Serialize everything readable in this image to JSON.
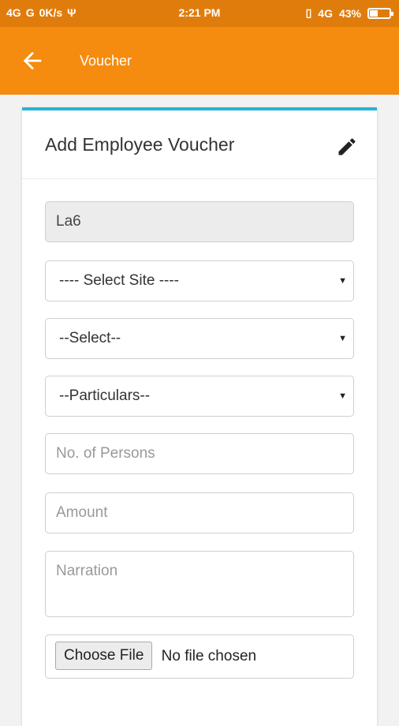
{
  "status_bar": {
    "network1": "4G",
    "network2": "G",
    "speed": "0K/s",
    "time": "2:21 PM",
    "lte": "4G",
    "battery": "43%",
    "battery_level": 0.43
  },
  "toolbar": {
    "title": "Voucher"
  },
  "card": {
    "title": "Add Employee Voucher",
    "fields": {
      "employee": "La6",
      "site": "---- Select Site ----",
      "select": "--Select--",
      "particulars": "--Particulars--",
      "persons_placeholder": "No. of Persons",
      "amount_placeholder": "Amount",
      "narration_placeholder": "Narration",
      "file_button": "Choose File",
      "file_status": "No file chosen"
    }
  },
  "colors": {
    "statusbar": "#e07c0c",
    "toolbar": "#f58b0f",
    "card_accent": "#25b4d5"
  }
}
